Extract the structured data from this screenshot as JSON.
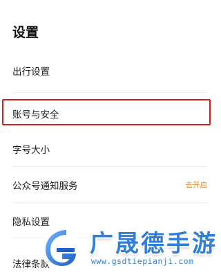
{
  "header": {
    "title": "设置"
  },
  "settings": {
    "items": [
      {
        "label": "出行设置"
      },
      {
        "label": "账号与安全"
      },
      {
        "label": "字号大小"
      },
      {
        "label": "公众号通知服务",
        "action": "去开启"
      },
      {
        "label": "隐私设置"
      },
      {
        "label": "法律条款"
      }
    ]
  },
  "highlight": {
    "color": "#cf1f1f",
    "target": "账号与安全"
  },
  "watermark": {
    "title": "广晟德手游",
    "url": "www.gsdtiepianji.com",
    "color": "#2f7fd8"
  }
}
